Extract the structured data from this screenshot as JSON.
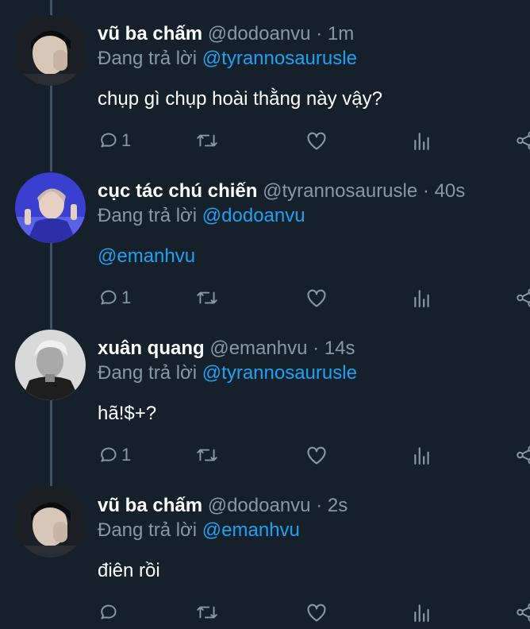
{
  "tweets": [
    {
      "name": "vũ ba chấm",
      "handle": "@dodoanvu",
      "time": "1m",
      "replying_prefix": "Đang trả lời",
      "replying_to": "@tyrannosaurusle",
      "text": "chụp gì chụp hoài thằng này vậy?",
      "reply_count": "1"
    },
    {
      "name": "cục tác chú chiến",
      "handle": "@tyrannosaurusle",
      "time": "40s",
      "replying_prefix": "Đang trả lời",
      "replying_to": "@dodoanvu",
      "text": "@emanhvu",
      "reply_count": "1"
    },
    {
      "name": "xuân quang",
      "handle": "@emanhvu",
      "time": "14s",
      "replying_prefix": "Đang trả lời",
      "replying_to": "@tyrannosaurusle",
      "text": "hã!$+?",
      "reply_count": "1"
    },
    {
      "name": "vũ ba chấm",
      "handle": "@dodoanvu",
      "time": "2s",
      "replying_prefix": "Đang trả lời",
      "replying_to": "@emanhvu",
      "text": "điên rồi",
      "reply_count": ""
    }
  ],
  "separator": "·",
  "icons": {
    "reply": "reply-icon",
    "retweet": "retweet-icon",
    "like": "like-icon",
    "analytics": "analytics-icon",
    "share": "share-icon"
  },
  "colors": {
    "background": "#15202b",
    "link": "#1da1f2",
    "secondary_text": "#8899a6",
    "thread_line": "#3d5466"
  }
}
